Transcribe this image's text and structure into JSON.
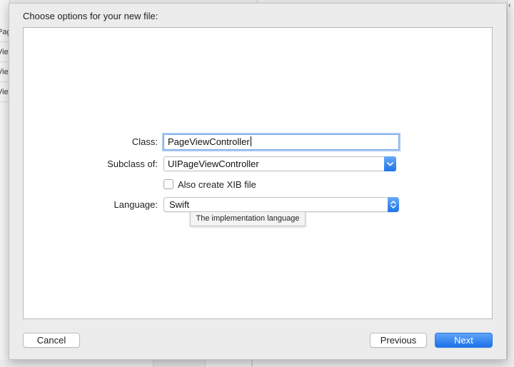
{
  "background": {
    "left_rows": [
      "Pag",
      "Vie",
      "Vie",
      "Vie"
    ]
  },
  "sheet": {
    "title": "Choose options for your new file:"
  },
  "form": {
    "class_label": "Class:",
    "class_value": "PageViewController",
    "subclass_label": "Subclass of:",
    "subclass_value": "UIPageViewController",
    "xib_label": "Also create XIB file",
    "xib_checked": false,
    "language_label": "Language:",
    "language_value": "Swift",
    "language_tooltip": "The implementation language"
  },
  "buttons": {
    "cancel": "Cancel",
    "previous": "Previous",
    "next": "Next"
  },
  "colors": {
    "accent": "#1c72e9",
    "focus_ring": "#a9c8f2"
  },
  "icons": {
    "combo": "chevron-down-icon",
    "popup": "up-down-chevron-icon",
    "bg_right": "chevron-left-icon"
  }
}
